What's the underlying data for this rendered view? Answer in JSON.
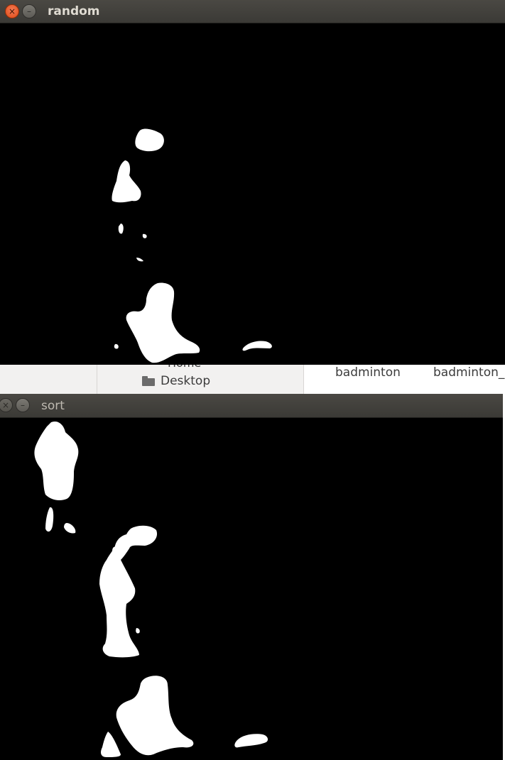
{
  "windows": {
    "random": {
      "title": "random",
      "close_glyph": "×",
      "minimize_glyph": "–"
    },
    "sort": {
      "title": "sort",
      "close_glyph": "×",
      "minimize_glyph": "–"
    }
  },
  "file_manager": {
    "home_label": "Home",
    "desktop_label": "Desktop",
    "files": [
      "badminton",
      "badminton_"
    ],
    "folder_icon": "folder-icon"
  },
  "colors": {
    "titlebar": "#3f3e3a",
    "close_active": "#e9541e",
    "mask_background": "#000000",
    "mask_foreground": "#ffffff"
  }
}
